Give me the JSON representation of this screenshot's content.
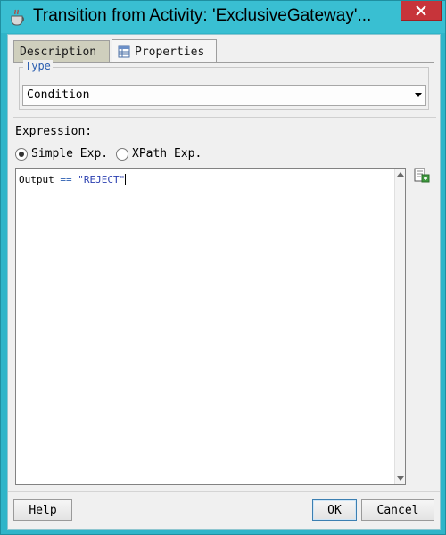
{
  "window": {
    "title": "Transition from Activity: 'ExclusiveGateway'..."
  },
  "tabs": [
    {
      "label": "Description",
      "active": false
    },
    {
      "label": "Properties",
      "active": true
    }
  ],
  "type_group": {
    "legend": "Type",
    "selected": "Condition"
  },
  "expression": {
    "label": "Expression:",
    "radio_simple": "Simple Exp.",
    "radio_xpath": "XPath Exp.",
    "selected_mode": "Simple Exp.",
    "text_lhs": "Output",
    "text_op": "==",
    "text_value": "\"REJECT\""
  },
  "buttons": {
    "help": "Help",
    "ok": "OK",
    "cancel": "Cancel"
  },
  "icons": {
    "app": "coffee-cup-icon",
    "close": "close-icon",
    "properties_tab": "table-icon",
    "expression_builder": "expression-builder-icon"
  },
  "colors": {
    "titlebar": "#39bfd2",
    "close": "#c7343a",
    "accent_blue": "#2a5db0"
  }
}
